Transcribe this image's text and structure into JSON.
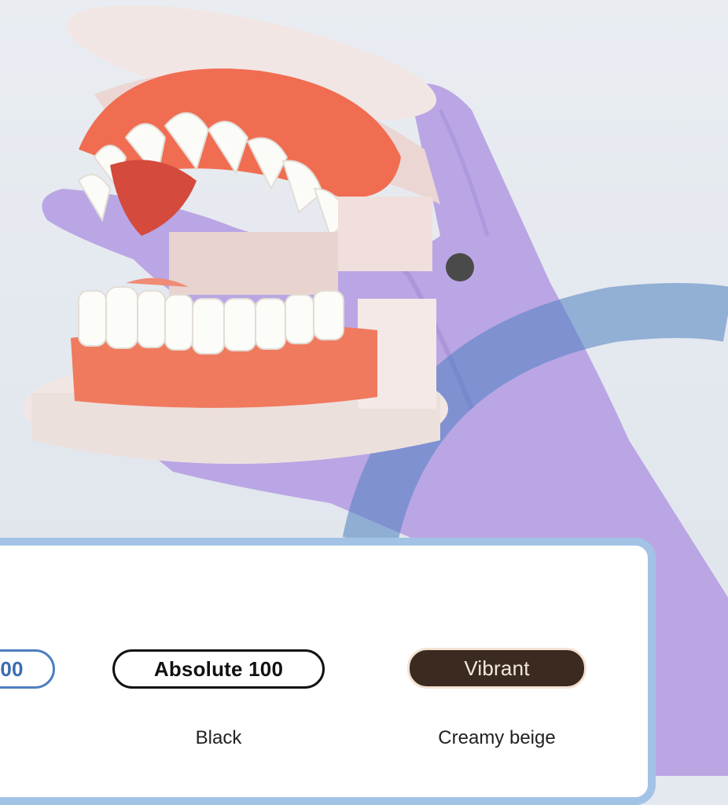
{
  "colors": {
    "card_border": "#a3c3e6",
    "blue_accent": "#4f7fbf",
    "black": "#111111",
    "brown": "#3b2a1f",
    "beige": "#f3e2d3",
    "glove": "#b39de0"
  },
  "photo": {
    "subject": "dental-model-in-gloved-hand"
  },
  "swatches": [
    {
      "label": "00",
      "caption": ""
    },
    {
      "label": "Absolute 100",
      "caption": "Black"
    },
    {
      "label": "Vibrant",
      "caption": "Creamy beige"
    }
  ]
}
